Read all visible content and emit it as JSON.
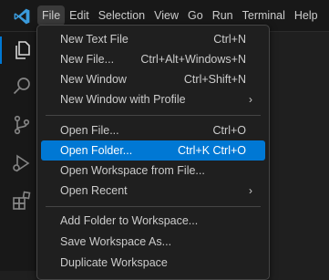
{
  "menubar": {
    "items": [
      {
        "label": "File"
      },
      {
        "label": "Edit"
      },
      {
        "label": "Selection"
      },
      {
        "label": "View"
      },
      {
        "label": "Go"
      },
      {
        "label": "Run"
      },
      {
        "label": "Terminal"
      },
      {
        "label": "Help"
      }
    ],
    "active_item": "File"
  },
  "file_menu": {
    "items": [
      {
        "label": "New Text File",
        "shortcut": "Ctrl+N"
      },
      {
        "label": "New File...",
        "shortcut": "Ctrl+Alt+Windows+N"
      },
      {
        "label": "New Window",
        "shortcut": "Ctrl+Shift+N"
      },
      {
        "label": "New Window with Profile",
        "shortcut": "",
        "submenu": true
      },
      {
        "label": "Open File...",
        "shortcut": "Ctrl+O"
      },
      {
        "label": "Open Folder...",
        "shortcut": "Ctrl+K Ctrl+O"
      },
      {
        "label": "Open Workspace from File...",
        "shortcut": ""
      },
      {
        "label": "Open Recent",
        "shortcut": "",
        "submenu": true
      },
      {
        "label": "Add Folder to Workspace...",
        "shortcut": ""
      },
      {
        "label": "Save Workspace As...",
        "shortcut": ""
      },
      {
        "label": "Duplicate Workspace",
        "shortcut": ""
      }
    ],
    "highlighted_item": "Open Folder...",
    "submenu_glyph": "›"
  },
  "activitybar": {
    "icons": [
      "explorer-icon",
      "search-icon",
      "source-control-icon",
      "run-debug-icon",
      "extensions-icon"
    ]
  },
  "colors": {
    "accent": "#0078d4",
    "menu_bg": "#1f1f1f",
    "text": "#cccccc",
    "highlight_text": "#ffffff"
  }
}
